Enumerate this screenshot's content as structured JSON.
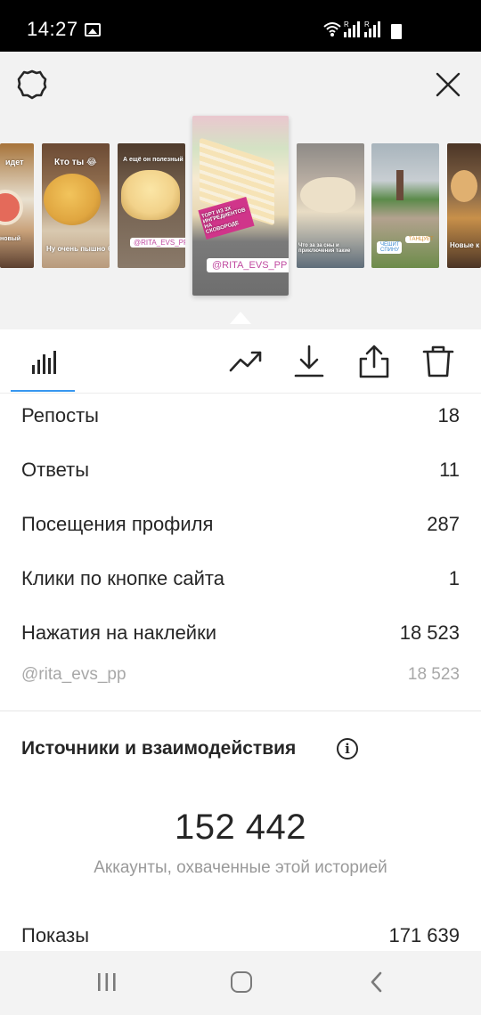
{
  "status_bar": {
    "time": "14:27",
    "icons": [
      "gallery-icon",
      "wifi-icon",
      "signal-icon",
      "signal-icon",
      "battery-icon"
    ]
  },
  "header": {
    "icons": [
      "settings-gear-icon",
      "close-icon"
    ]
  },
  "stories": {
    "thumbnails": [
      {
        "caption_top": "идет",
        "caption_bottom": "новый",
        "colors": [
          "#a6733a",
          "#e8e0d0",
          "#5c4030"
        ]
      },
      {
        "caption_top": "Кто ты 😂",
        "caption_bottom": "Ну очень пышно 😋",
        "colors": [
          "#6b4a34",
          "#e0a640",
          "#d9c9b0"
        ]
      },
      {
        "caption_top": "А ещё он полезный ❤",
        "tag": "@RITA_EVS_PP",
        "colors": [
          "#4e3a2c",
          "#f2d28a",
          "#8a7a6a"
        ]
      },
      {
        "caption_top": "ТОРТ ИЗ 3Х ИНГРЕДИЕНТОВ НА СКОВОРОДЕ",
        "tag": "@RITA_EVS_PP",
        "selected": true,
        "colors": [
          "#eac7cf",
          "#f6ead0",
          "#6e6e6e"
        ]
      },
      {
        "caption_bottom": "Что за за сны и приключения такие",
        "colors": [
          "#8d8a86",
          "#e8dcc4",
          "#5f6d7a"
        ]
      },
      {
        "tags": [
          "ЧЕШИТ СПИНУ",
          "ТАНЦУЕТ"
        ],
        "colors": [
          "#a8b4bc",
          "#5b8a4a",
          "#b3a28f"
        ]
      },
      {
        "caption_bottom": "Новые к",
        "colors": [
          "#4b3526",
          "#c8904a",
          "#8a6a4a"
        ]
      }
    ]
  },
  "toolbar": {
    "icons": [
      "bar-chart-icon",
      "trending-icon",
      "download-icon",
      "share-icon",
      "trash-icon"
    ]
  },
  "metrics": [
    {
      "label": "Репосты",
      "value": "18"
    },
    {
      "label": "Ответы",
      "value": "11"
    },
    {
      "label": "Посещения профиля",
      "value": "287"
    },
    {
      "label": "Клики по кнопке сайта",
      "value": "1"
    },
    {
      "label": "Нажатия на наклейки",
      "value": "18 523"
    }
  ],
  "sticker_detail": {
    "label": "@rita_evs_pp",
    "value": "18 523"
  },
  "section": {
    "title": "Источники и взаимодействия",
    "info_symbol": "i",
    "reach_value": "152 442",
    "reach_caption": "Аккаунты, охваченные этой историей",
    "impressions_label": "Показы",
    "impressions_value": "171 639"
  },
  "navbar": {
    "icons": [
      "recents-icon",
      "home-icon",
      "back-icon"
    ]
  },
  "colors": {
    "accent": "#3897f0",
    "text": "#262626",
    "muted": "#a8a8a8"
  }
}
